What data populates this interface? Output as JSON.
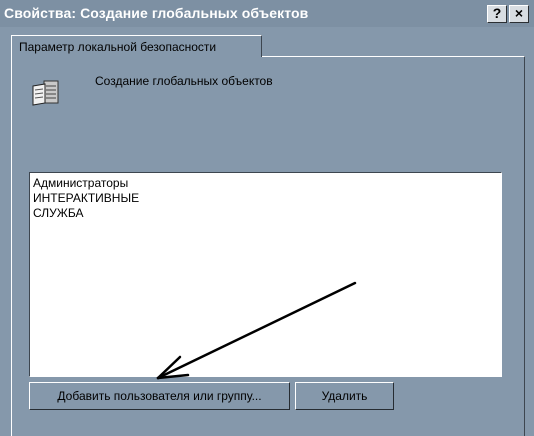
{
  "window": {
    "title": "Свойства: Создание глобальных объектов",
    "help_label": "?",
    "close_label": "×"
  },
  "tabs": [
    {
      "label": "Параметр локальной безопасности"
    }
  ],
  "policy": {
    "icon": "security-policy-icon",
    "title": "Создание глобальных объектов"
  },
  "list": {
    "items": [
      "Администраторы",
      "ИНТЕРАКТИВНЫЕ",
      "СЛУЖБА"
    ]
  },
  "buttons": {
    "add_label": "Добавить пользователя или группу...",
    "remove_label": "Удалить"
  },
  "colors": {
    "background": "#8598ab",
    "title_text": "#ffffff",
    "list_background": "#ffffff",
    "annotation_arrow": "#000000"
  }
}
